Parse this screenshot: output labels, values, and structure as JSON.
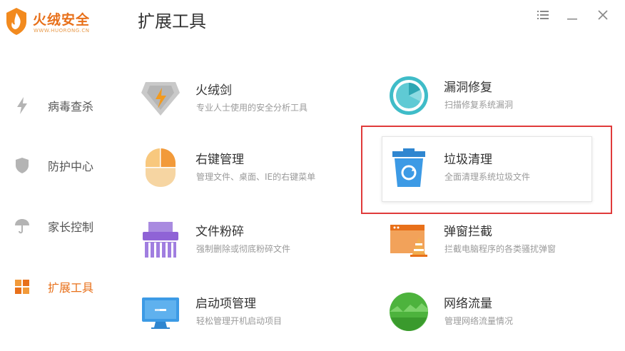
{
  "app": {
    "name": "火绒安全",
    "site": "WWW.HUORONG.CN"
  },
  "header": {
    "title": "扩展工具"
  },
  "window_controls": {
    "menu": "☰",
    "minimize": "—",
    "close": "✕"
  },
  "sidebar": {
    "items": [
      {
        "label": "病毒查杀",
        "icon": "lightning-icon"
      },
      {
        "label": "防护中心",
        "icon": "shield-icon"
      },
      {
        "label": "家长控制",
        "icon": "umbrella-icon"
      },
      {
        "label": "扩展工具",
        "icon": "extension-grid-icon",
        "active": true
      }
    ]
  },
  "tools": [
    {
      "title": "火绒剑",
      "desc": "专业人士使用的安全分析工具",
      "icon": "sword-icon"
    },
    {
      "title": "漏洞修复",
      "desc": "扫描修复系统漏洞",
      "icon": "vulnerability-repair-icon"
    },
    {
      "title": "右键管理",
      "desc": "管理文件、桌面、IE的右键菜单",
      "icon": "mouse-icon"
    },
    {
      "title": "垃圾清理",
      "desc": "全面清理系统垃圾文件",
      "icon": "trash-clean-icon",
      "highlighted": true
    },
    {
      "title": "文件粉碎",
      "desc": "强制删除或彻底粉碎文件",
      "icon": "file-shredder-icon"
    },
    {
      "title": "弹窗拦截",
      "desc": "拦截电脑程序的各类骚扰弹窗",
      "icon": "popup-block-icon"
    },
    {
      "title": "启动项管理",
      "desc": "轻松管理开机启动项目",
      "icon": "monitor-icon"
    },
    {
      "title": "网络流量",
      "desc": "管理网络流量情况",
      "icon": "network-traffic-icon"
    }
  ],
  "colors": {
    "accent": "#e8701a",
    "highlight": "#e03b3b",
    "text": "#333333",
    "muted": "#9a9a9a"
  }
}
